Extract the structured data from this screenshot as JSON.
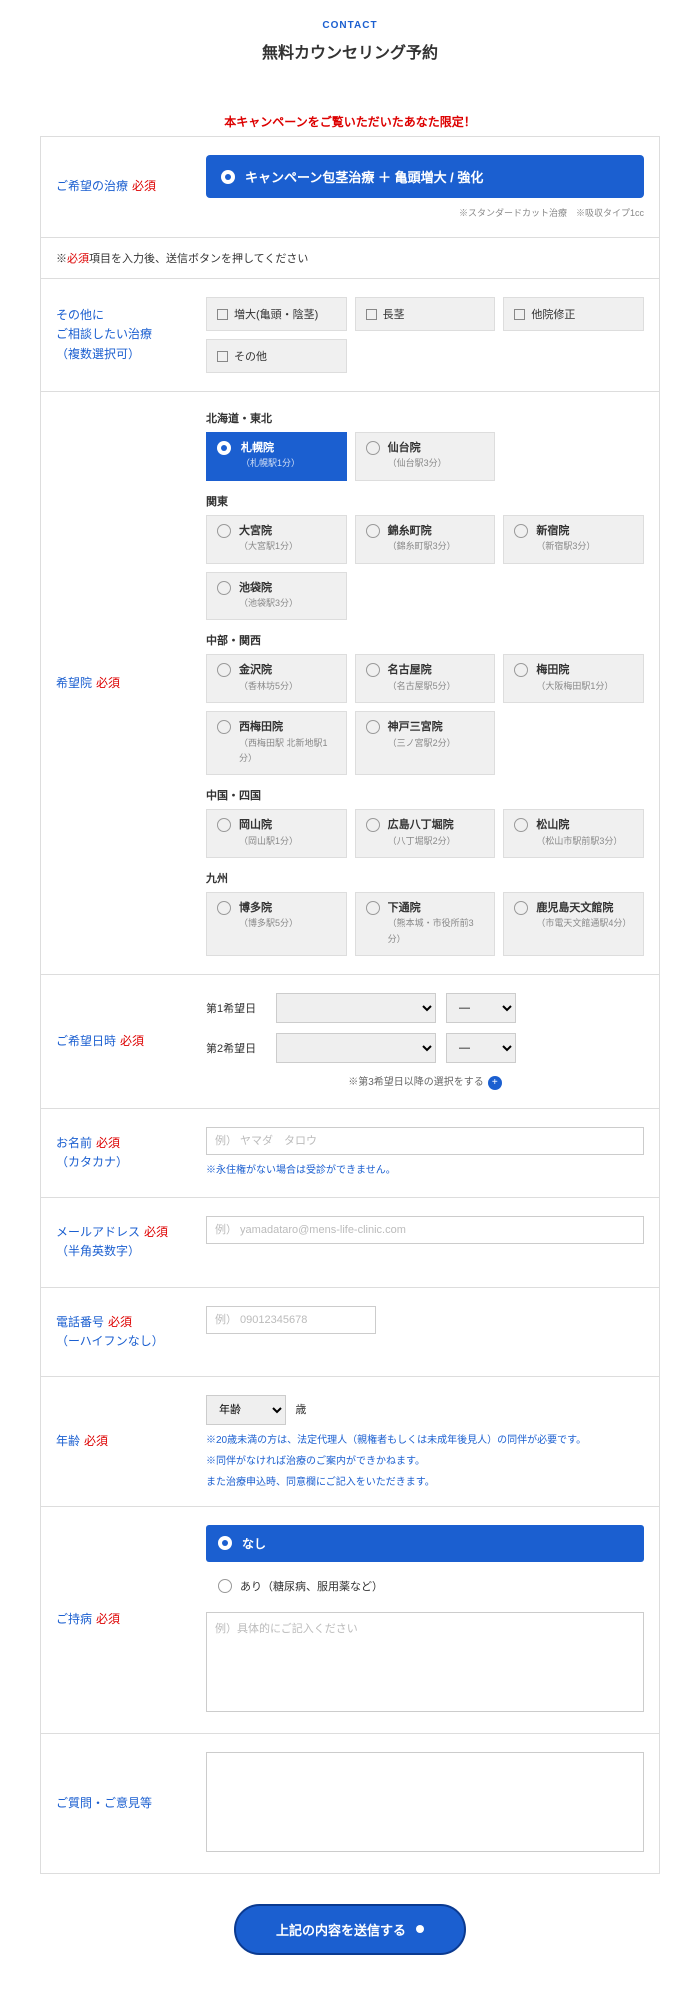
{
  "header": {
    "eyebrow": "CONTACT",
    "title": "無料カウンセリング予約"
  },
  "campaign_notice": "本キャンペーンをご覧いただいたあなた限定！",
  "treatment": {
    "label": "ご希望の治療",
    "required": "必須",
    "option": "キャンペーン包茎治療 ＋ 亀頭増大 / 強化",
    "note": "※スタンダードカット治療　※吸収タイプ1cc"
  },
  "required_note_prefix": "※",
  "required_note_red": "必須",
  "required_note_suffix": "項目を入力後、送信ボタンを押してください",
  "other": {
    "label_l1": "その他に",
    "label_l2": "ご相談したい治療",
    "label_l3": "（複数選択可）",
    "items": [
      "増大(亀頭・陰茎)",
      "長茎",
      "他院修正",
      "その他"
    ]
  },
  "clinic": {
    "label": "希望院",
    "required": "必須",
    "regions": [
      {
        "name": "北海道・東北",
        "items": [
          {
            "nm": "札幌院",
            "sub": "（札幌駅1分）",
            "selected": true
          },
          {
            "nm": "仙台院",
            "sub": "（仙台駅3分）"
          }
        ]
      },
      {
        "name": "関東",
        "items": [
          {
            "nm": "大宮院",
            "sub": "（大宮駅1分）"
          },
          {
            "nm": "錦糸町院",
            "sub": "（錦糸町駅3分）"
          },
          {
            "nm": "新宿院",
            "sub": "（新宿駅3分）"
          },
          {
            "nm": "池袋院",
            "sub": "（池袋駅3分）"
          }
        ]
      },
      {
        "name": "中部・関西",
        "items": [
          {
            "nm": "金沢院",
            "sub": "（香林坊5分）"
          },
          {
            "nm": "名古屋院",
            "sub": "（名古屋駅5分）"
          },
          {
            "nm": "梅田院",
            "sub": "（大阪梅田駅1分）"
          },
          {
            "nm": "西梅田院",
            "sub": "（西梅田駅 北新地駅1分）"
          },
          {
            "nm": "神戸三宮院",
            "sub": "（三ノ宮駅2分）"
          }
        ]
      },
      {
        "name": "中国・四国",
        "items": [
          {
            "nm": "岡山院",
            "sub": "（岡山駅1分）"
          },
          {
            "nm": "広島八丁堀院",
            "sub": "（八丁堀駅2分）"
          },
          {
            "nm": "松山院",
            "sub": "（松山市駅前駅3分）"
          }
        ]
      },
      {
        "name": "九州",
        "items": [
          {
            "nm": "博多院",
            "sub": "（博多駅5分）"
          },
          {
            "nm": "下通院",
            "sub": "（熊本城・市役所前3分）"
          },
          {
            "nm": "鹿児島天文館院",
            "sub": "（市電天文館通駅4分）"
          }
        ]
      }
    ]
  },
  "datetime": {
    "label": "ご希望日時",
    "required": "必須",
    "l1": "第1希望日",
    "l2": "第2希望日",
    "time_dash": "—",
    "note": "※第3希望日以降の選択をする"
  },
  "name": {
    "label_l1": "お名前",
    "label_l2": "（カタカナ）",
    "required": "必須",
    "placeholder": "例） ヤマダ　タロウ",
    "hint": "※永住権がない場合は受診ができません。"
  },
  "email": {
    "label_l1": "メールアドレス",
    "label_l2": "（半角英数字）",
    "required": "必須",
    "placeholder": "例） yamadataro@mens-life-clinic.com"
  },
  "phone": {
    "label_l1": "電話番号",
    "label_l2": "（ーハイフンなし）",
    "required": "必須",
    "placeholder": "例） 09012345678"
  },
  "age": {
    "label": "年齢",
    "required": "必須",
    "placeholder": "年齢",
    "unit": "歳",
    "hint1": "※20歳未満の方は、法定代理人（親権者もしくは未成年後見人）の同伴が必要です。",
    "hint2": "※同伴がなければ治療のご案内ができかねます。",
    "hint3": "また治療申込時、同意欄にご記入をいただきます。"
  },
  "illness": {
    "label": "ご持病",
    "required": "必須",
    "opt_none": "なし",
    "opt_yes": "あり（糖尿病、服用薬など）",
    "placeholder": "例）具体的にご記入ください"
  },
  "comments": {
    "label": "ご質問・ご意見等"
  },
  "submit": "上記の内容を送信する"
}
